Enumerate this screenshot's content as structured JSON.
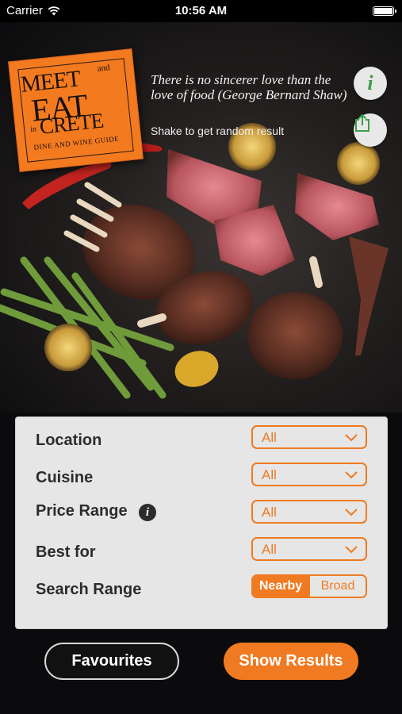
{
  "status_bar": {
    "carrier": "Carrier",
    "time": "10:56 AM"
  },
  "logo": {
    "line1": "MEET",
    "and": "and",
    "line2": "EAT",
    "in": "in",
    "line3": "CRETE",
    "subtitle": "DINE AND WINE GUIDE"
  },
  "quote": "There is no sincerer love than the love of food (George Bernard Shaw)",
  "shake_hint": "Shake to get random result",
  "icons": {
    "info": "info-icon",
    "share": "share-icon"
  },
  "filters": {
    "location": {
      "label": "Location",
      "value": "All"
    },
    "cuisine": {
      "label": "Cuisine",
      "value": "All"
    },
    "price_range": {
      "label": "Price Range",
      "value": "All"
    },
    "best_for": {
      "label": "Best for",
      "value": "All"
    },
    "search_range": {
      "label": "Search Range",
      "options": [
        "Nearby",
        "Broad"
      ],
      "selected": "Nearby"
    }
  },
  "buttons": {
    "favourites": "Favourites",
    "show_results": "Show Results"
  },
  "colors": {
    "accent": "#ef7a22",
    "info_green": "#3d9c4a",
    "panel": "#e6e6e6"
  }
}
